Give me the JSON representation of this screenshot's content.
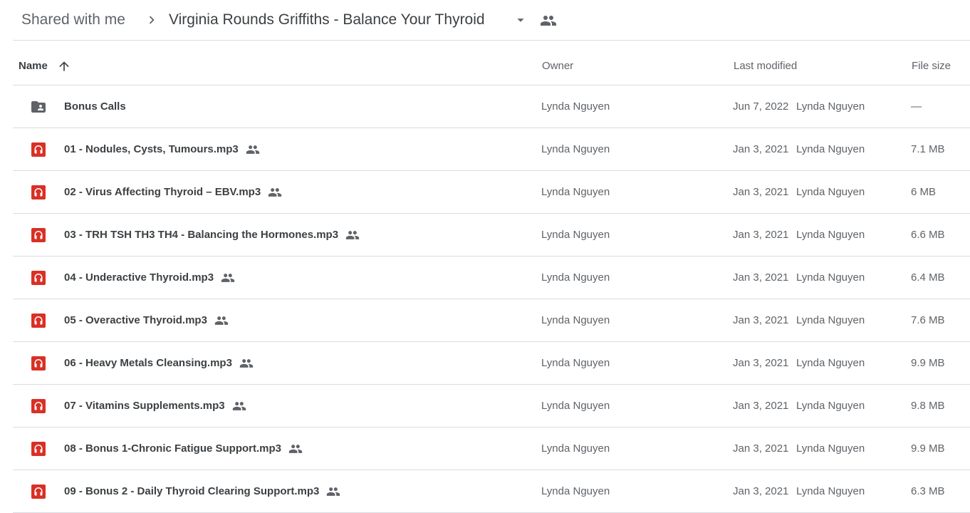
{
  "breadcrumb": {
    "root": "Shared with me",
    "current": "Virginia Rounds Griffiths - Balance Your Thyroid",
    "icons": {
      "separator": "chevron-right-icon",
      "dropdown": "caret-down-icon",
      "shared": "people-icon"
    }
  },
  "columns": {
    "name": "Name",
    "owner": "Owner",
    "modified": "Last modified",
    "size": "File size",
    "sort_icon": "arrow-up-icon"
  },
  "colors": {
    "text_primary": "#3c4043",
    "text_secondary": "#5f6368",
    "divider": "#dadce0",
    "audio_red": "#d93025",
    "folder_gray": "#5f6368"
  },
  "rows": [
    {
      "type": "folder",
      "name": "Bonus Calls",
      "shared": false,
      "owner": "Lynda Nguyen",
      "modified": "Jun 7, 2022",
      "modified_by": "Lynda Nguyen",
      "size": "—"
    },
    {
      "type": "audio",
      "name": "01 - Nodules, Cysts, Tumours.mp3",
      "shared": true,
      "owner": "Lynda Nguyen",
      "modified": "Jan 3, 2021",
      "modified_by": "Lynda Nguyen",
      "size": "7.1 MB"
    },
    {
      "type": "audio",
      "name": "02 - Virus Affecting Thyroid – EBV.mp3",
      "shared": true,
      "owner": "Lynda Nguyen",
      "modified": "Jan 3, 2021",
      "modified_by": "Lynda Nguyen",
      "size": "6 MB"
    },
    {
      "type": "audio",
      "name": "03 - TRH TSH TH3 TH4 - Balancing the Hormones.mp3",
      "shared": true,
      "owner": "Lynda Nguyen",
      "modified": "Jan 3, 2021",
      "modified_by": "Lynda Nguyen",
      "size": "6.6 MB"
    },
    {
      "type": "audio",
      "name": "04 - Underactive Thyroid.mp3",
      "shared": true,
      "owner": "Lynda Nguyen",
      "modified": "Jan 3, 2021",
      "modified_by": "Lynda Nguyen",
      "size": "6.4 MB"
    },
    {
      "type": "audio",
      "name": "05 - Overactive Thyroid.mp3",
      "shared": true,
      "owner": "Lynda Nguyen",
      "modified": "Jan 3, 2021",
      "modified_by": "Lynda Nguyen",
      "size": "7.6 MB"
    },
    {
      "type": "audio",
      "name": "06 - Heavy Metals Cleansing.mp3",
      "shared": true,
      "owner": "Lynda Nguyen",
      "modified": "Jan 3, 2021",
      "modified_by": "Lynda Nguyen",
      "size": "9.9 MB"
    },
    {
      "type": "audio",
      "name": "07 - Vitamins Supplements.mp3",
      "shared": true,
      "owner": "Lynda Nguyen",
      "modified": "Jan 3, 2021",
      "modified_by": "Lynda Nguyen",
      "size": "9.8 MB"
    },
    {
      "type": "audio",
      "name": "08 - Bonus 1-Chronic Fatigue Support.mp3",
      "shared": true,
      "owner": "Lynda Nguyen",
      "modified": "Jan 3, 2021",
      "modified_by": "Lynda Nguyen",
      "size": "9.9 MB"
    },
    {
      "type": "audio",
      "name": "09 - Bonus 2 - Daily Thyroid Clearing Support.mp3",
      "shared": true,
      "owner": "Lynda Nguyen",
      "modified": "Jan 3, 2021",
      "modified_by": "Lynda Nguyen",
      "size": "6.3 MB"
    }
  ]
}
